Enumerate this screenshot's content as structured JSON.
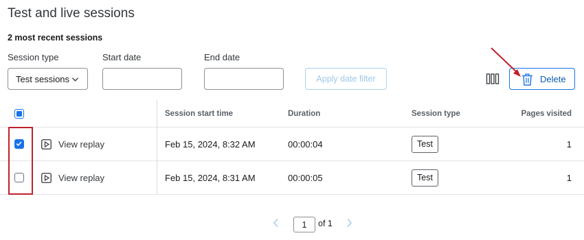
{
  "header": {
    "title": "Test and live sessions",
    "subtitle": "2 most recent sessions"
  },
  "filters": {
    "session_type_label": "Session type",
    "session_type_value": "Test sessions",
    "start_date_label": "Start date",
    "start_date_value": "",
    "end_date_label": "End date",
    "end_date_value": "",
    "apply_label": "Apply date filter"
  },
  "toolbar": {
    "delete_label": "Delete"
  },
  "table": {
    "columns": [
      "Session start time",
      "Duration",
      "Session type",
      "Pages visited"
    ],
    "rows": [
      {
        "checked": true,
        "action": "View replay",
        "start": "Feb 15, 2024, 8:32 AM",
        "duration": "00:00:04",
        "type": "Test",
        "pages": "1"
      },
      {
        "checked": false,
        "action": "View replay",
        "start": "Feb 15, 2024, 8:31 AM",
        "duration": "00:00:05",
        "type": "Test",
        "pages": "1"
      }
    ]
  },
  "pagination": {
    "current": "1",
    "of_label": "of 1"
  },
  "colors": {
    "accent": "#1a73e8",
    "annotation": "#c0202c"
  }
}
